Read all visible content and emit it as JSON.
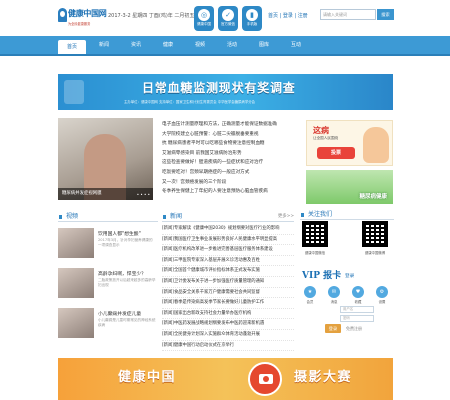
{
  "header": {
    "logo_text": "健康中国网",
    "logo_sub": "为全民健康服务",
    "date": "2017-3-2 星期四 丁酉(鸡)年 二月初五",
    "apps": [
      {
        "caption": "健康中国",
        "glyph": "◎"
      },
      {
        "caption": "官方微信",
        "glyph": "✓"
      },
      {
        "caption": "手机版",
        "glyph": "▮"
      }
    ],
    "user_links": "首页 | 登录 | 注册",
    "search_placeholder": "请输入关键词",
    "search_button": "搜索"
  },
  "nav": {
    "items": [
      "首页",
      "新闻",
      "资讯",
      "健康",
      "视频",
      "活动",
      "图库",
      "互动"
    ]
  },
  "banner": {
    "title": "日常血糖监测现状有奖调查",
    "subtitle": "主办单位：健康中国网  支持单位：国家卫生和计划生育委员会   中华医学会糖尿病学分会"
  },
  "headline": {
    "photo_caption": "糖尿病并发症视网膜",
    "photo_dots": "• • • •",
    "items": [
      "电子血压计测量原理和方法，正确测量才能保证数据准确",
      "大学院校建立心脏预警：心脏二尖瓣脱垂要重视",
      "抗 糖尿病患者平时可以吃哪些食物要注意控制血糖",
      "艾滋病零感染目 前我国艾滋病防治形势",
      "这些检查要做好！胆道疾病的一些症状和应对治疗",
      "吃饭要吃对！宫颈早期癌症的一般应对方式",
      "又一次！宫颈癌发展的三个阶段",
      "冬季养生保健上了年纪的人要注意预防心脑血管疾病"
    ]
  },
  "ads": {
    "survey_big": "这病",
    "survey_small": "让全国人民围绕",
    "survey_vote": "投票",
    "diabetes_text": "糖尿病健康"
  },
  "video": {
    "header": "视频",
    "items": [
      {
        "title": "饮用国人都\"想生酸\"",
        "desc": "2017年3月，针对孕妇营养健康的一项调查显示"
      },
      {
        "title": "高龄孕妇啊，悍宝少？",
        "desc": "二胎政策放开以后越来越多的高龄孕妇出现"
      },
      {
        "title": "小儿癫痫并发症儿童",
        "desc": "小儿癫痫是儿童时期常见的神经系统疾病"
      }
    ]
  },
  "news": {
    "header": "新闻",
    "more": "更多>>",
    "items": [
      "[新闻]专家解读《健康中国2030》规划纲要对医疗行业的影响",
      "[新闻]我国医疗卫生事业发展形势良好人民健康水平明显提高",
      "[新闻]医疗机构改革进一步推进完善基层医疗服务体系建设",
      "[新闻]三甲医院专家深入基层开展义诊活动惠及百姓",
      "[新闻]全国首个健康城市评价指标体系正式发布实施",
      "[新闻]卫计委发布关于进一步加强医疗质量管理的通知",
      "[新闻]食品安全关系千家万户健康需要社会共同监督",
      "[新闻]春季是传染病高发季节家长要做好儿童防护工作",
      "[新闻]国家出台新政支持社会力量举办医疗机构",
      "[新闻]中医药发展战略规划纲要发布中医药迎来新机遇",
      "[新闻]全民健身计划深入实施群众体育活动蓬勃开展",
      "[新闻]健康中国行动启动仪式在京举行"
    ]
  },
  "sidebar": {
    "follow_header": "关注我们",
    "qr_captions": [
      "健康中国微信",
      "健康中国微博"
    ],
    "vip_title": "VIP 报卡",
    "vip_sub": "登录",
    "vip_icons": [
      {
        "glyph": "★",
        "cap": "会员"
      },
      {
        "glyph": "✉",
        "cap": "消息"
      },
      {
        "glyph": "♥",
        "cap": "收藏"
      },
      {
        "glyph": "⚙",
        "cap": "设置"
      }
    ],
    "username_placeholder": "用户名",
    "password_placeholder": "密码",
    "login_button": "登录",
    "register_link": "免费注册"
  },
  "photo_banner": {
    "left": "健康中国",
    "right": "摄影大赛"
  },
  "colors": {
    "nav": "#3d9ad5",
    "brand": "#1b70b4",
    "banner": "#3cb0e6",
    "photo_banner": "#f4c259"
  }
}
